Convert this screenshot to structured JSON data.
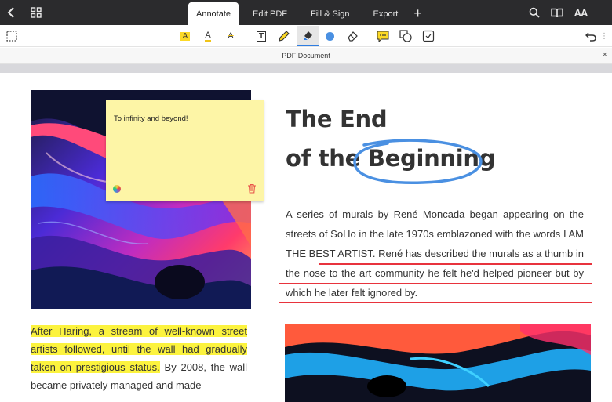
{
  "tabs": [
    {
      "label": "Annotate",
      "active": true
    },
    {
      "label": "Edit PDF",
      "active": false
    },
    {
      "label": "Fill & Sign",
      "active": false
    },
    {
      "label": "Export",
      "active": false
    }
  ],
  "topbar": {
    "add_tab_label": "+",
    "text_size_label": "AA"
  },
  "toolbar": {
    "highlight_label": "A",
    "underline_label": "A",
    "strikeout_label": "A",
    "textbox_label": "T"
  },
  "docbar": {
    "title": "PDF Document",
    "close_label": "×"
  },
  "note": {
    "text": "To infinity and beyond!"
  },
  "article": {
    "heading_line1": "The End",
    "heading_line2_prefix": "of the ",
    "heading_line2_circled": "Beginning",
    "paragraph": "A series of murals by René Moncada began appearing on the streets of SoHo in the late 1970s emblazoned with the words I AM THE BEST ARTIST. René has described the murals as a thumb in the nose to the art community he felt he'd helped pioneer but by which he later felt ignored by.",
    "left_highlighted": "After Haring, a stream of well-known street artists followed, until the wall had gradually taken on prestigious status.",
    "left_rest": " By 2008, the wall became privately managed and made"
  },
  "colors": {
    "accent": "#2f7de1",
    "underline": "#e8333d",
    "highlight": "#fcf33e",
    "note": "#fdf5a6",
    "circle": "#4a90e2"
  }
}
